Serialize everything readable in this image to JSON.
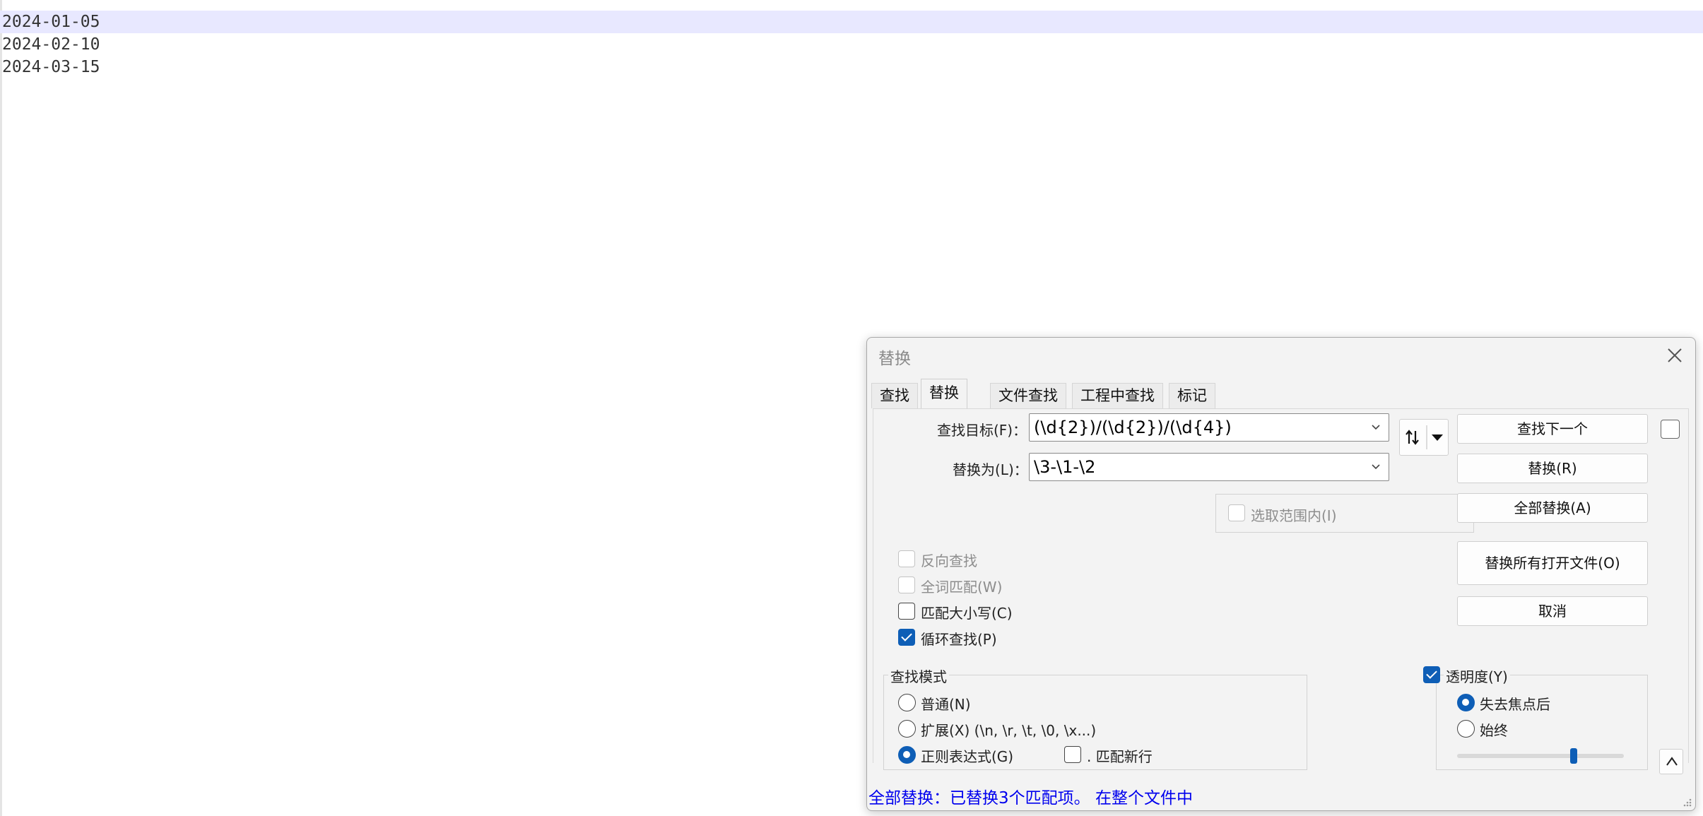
{
  "editor": {
    "lines": [
      "2024-01-05",
      "2024-02-10",
      "2024-03-15"
    ]
  },
  "dialog": {
    "title": "替换",
    "tabs": [
      "查找",
      "替换",
      "文件查找",
      "工程中查找",
      "标记"
    ],
    "active_tab": "替换",
    "find": {
      "label": "查找目标(F)：",
      "value": "(\\d{2})/(\\d{2})/(\\d{4})"
    },
    "replace": {
      "label": "替换为(L)：",
      "value": "\\3-\\1-\\2"
    },
    "in_selection": {
      "label": "选取范围内(I)",
      "checked": false,
      "enabled": false
    },
    "buttons": {
      "find_next": "查找下一个",
      "replace": "替换(R)",
      "replace_all": "全部替换(A)",
      "replace_all_open": "替换所有打开文件(O)",
      "cancel": "取消"
    },
    "options": {
      "backward": {
        "label": "反向查找",
        "checked": false,
        "enabled": false
      },
      "whole_word": {
        "label": "全词匹配(W)",
        "checked": false,
        "enabled": false
      },
      "match_case": {
        "label": "匹配大小写(C)",
        "checked": false,
        "enabled": true
      },
      "wrap": {
        "label": "循环查找(P)",
        "checked": true,
        "enabled": true
      }
    },
    "search_mode": {
      "title": "查找模式",
      "normal": "普通(N)",
      "extended": "扩展(X) (\\n, \\r, \\t, \\0, \\x...)",
      "regex": "正则表达式(G)",
      "dot_newline": ". 匹配新行",
      "selected": "regex"
    },
    "transparency": {
      "label": "透明度(Y)",
      "checked": true,
      "on_lose_focus": "失去焦点后",
      "always": "始终",
      "selected": "on_lose_focus",
      "level": 0.7
    },
    "status": "全部替换：已替换3个匹配项。 在整个文件中"
  },
  "colors": {
    "accent": "#0e5eb6",
    "status": "#0000ee",
    "current_line": "#e8e8ff"
  }
}
